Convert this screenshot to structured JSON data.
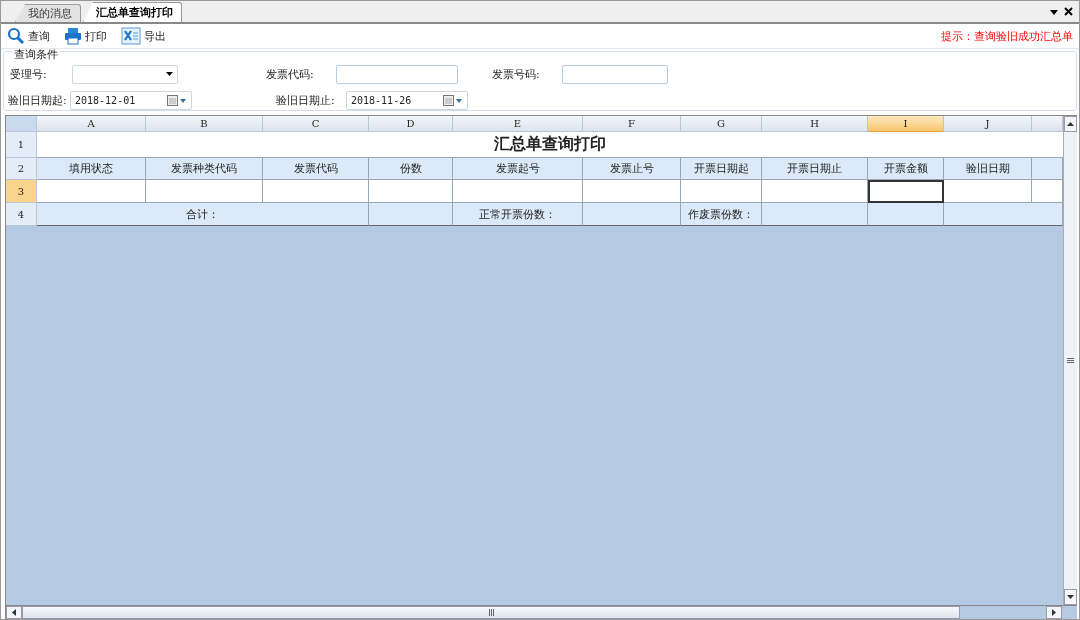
{
  "tabs": [
    {
      "label": "我的消息",
      "selected": false
    },
    {
      "label": "汇总单查询打印",
      "selected": true
    }
  ],
  "toolbar": {
    "buttons": [
      {
        "kind": "search",
        "label": "查询"
      },
      {
        "kind": "print",
        "label": "打印"
      },
      {
        "kind": "export",
        "label": "导出"
      }
    ],
    "hint": "提示：查询验旧成功汇总单"
  },
  "query": {
    "title": "查询条件",
    "fields": [
      {
        "kind": "dropdown",
        "label": "受理号:"
      },
      {
        "kind": "text",
        "label": "发票代码:"
      },
      {
        "kind": "text",
        "label": "发票号码:"
      },
      {
        "kind": "date",
        "label": "验旧日期起:",
        "value": "2018-12-01"
      },
      {
        "kind": "date",
        "label": "验旧日期止:",
        "value": "2018-11-26"
      }
    ]
  },
  "sheet": {
    "columns": [
      {
        "letter": "A",
        "selected": false
      },
      {
        "letter": "B",
        "selected": false
      },
      {
        "letter": "C",
        "selected": false
      },
      {
        "letter": "D",
        "selected": false
      },
      {
        "letter": "E",
        "selected": false
      },
      {
        "letter": "F",
        "selected": false
      },
      {
        "letter": "G",
        "selected": false
      },
      {
        "letter": "H",
        "selected": false
      },
      {
        "letter": "I",
        "selected": true
      },
      {
        "letter": "J",
        "selected": false
      }
    ],
    "rows": [
      {
        "number": "1",
        "selected": false
      },
      {
        "number": "2",
        "selected": false
      },
      {
        "number": "3",
        "selected": true
      },
      {
        "number": "4",
        "selected": false
      }
    ],
    "title": "汇总单查询打印",
    "header_cells": [
      "填用状态",
      "发票种类代码",
      "发票代码",
      "份数",
      "发票起号",
      "发票止号",
      "开票日期起",
      "开票日期止",
      "开票金额",
      "验旧日期"
    ],
    "data_cells": [
      {
        "selected": false
      },
      {
        "selected": false
      },
      {
        "selected": false
      },
      {
        "selected": false
      },
      {
        "selected": false
      },
      {
        "selected": false
      },
      {
        "selected": false
      },
      {
        "selected": false
      },
      {
        "selected": true
      },
      {
        "selected": false
      }
    ],
    "total_label": "合计：",
    "normal_count_label": "正常开票份数：",
    "void_count_label": "作废票份数："
  }
}
